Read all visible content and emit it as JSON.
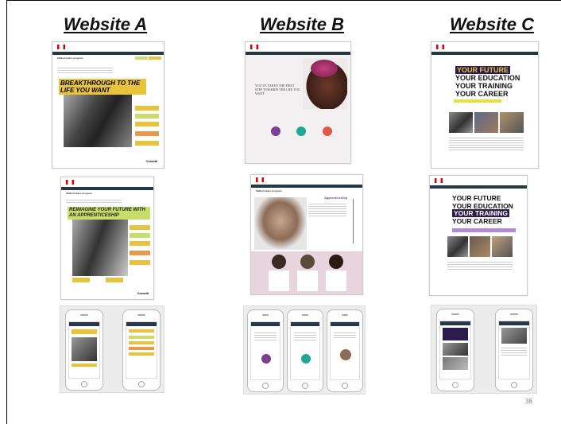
{
  "columns": [
    {
      "title": "Website A"
    },
    {
      "title": "Website B"
    },
    {
      "title": "Website C"
    }
  ],
  "website_a": {
    "headline_1": "Breakthrough to the life you want",
    "headline_2": "Reimagine your future with an apprenticeship",
    "section_title_1": "Skilled trades program",
    "section_title_2": "Skilled trades program"
  },
  "website_b": {
    "tagline": "You've taken the first step towards the life you want",
    "section_title": "Skilled trades program",
    "subhead": "Apprenticeship"
  },
  "website_c": {
    "line_1": "Your future",
    "line_2": "Your education",
    "line_3": "Your training",
    "line_4": "Your career"
  },
  "page_number": "38",
  "colors": {
    "gc_navy": "#26374a",
    "yellow": "#e8c33c",
    "purple": "#2b1b4e",
    "pink_bg": "#e8d4dc"
  }
}
